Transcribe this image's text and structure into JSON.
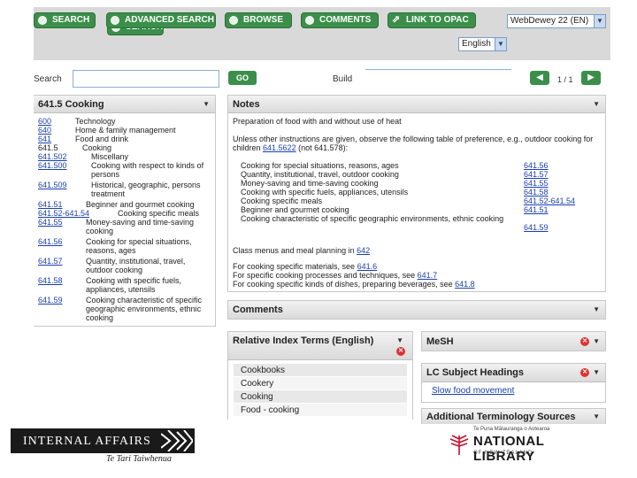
{
  "toolbar": {
    "buttons": [
      "SEARCH",
      "ADVANCED SEARCH",
      "BROWSE",
      "COMMENTS",
      "LINK TO OPAC"
    ],
    "edition": "WebDewey 22 (EN)",
    "language": "English"
  },
  "search": {
    "label": "Search",
    "value": "",
    "go": "GO",
    "build_label": "Build",
    "pager": "1 / 1"
  },
  "hierarchy": {
    "title": "641.5 Cooking",
    "rows": [
      {
        "num": "600",
        "cap": "Technology"
      },
      {
        "num": "640",
        "cap": "Home & family management"
      },
      {
        "num": "641",
        "cap": "Food and drink"
      },
      {
        "num": "641.5",
        "cap": "Cooking"
      },
      {
        "num": "641.502",
        "cap": "Miscellany"
      },
      {
        "num": "641.500",
        "cap": "Cooking with respect to kinds of persons"
      },
      {
        "num": "641.509",
        "cap": "Historical, geographic, persons treatment"
      },
      {
        "num": "641.51",
        "cap": "Beginner and gourmet cooking"
      },
      {
        "num": "641.52-641.54",
        "cap": "Cooking specific meals"
      },
      {
        "num": "641.55",
        "cap": "Money-saving and time-saving cooking"
      },
      {
        "num": "641.56",
        "cap": "Cooking for special situations, reasons, ages"
      },
      {
        "num": "641.57",
        "cap": "Quantity, institutional, travel, outdoor cooking"
      },
      {
        "num": "641.58",
        "cap": "Cooking with specific fuels, appliances, utensils"
      },
      {
        "num": "641.59",
        "cap": "Cooking characteristic of specific geographic environments, ethnic cooking"
      }
    ]
  },
  "notes": {
    "title": "Notes",
    "definition": "Preparation of food with and without use of heat",
    "instruction_a": "Unless other instructions are given, observe the following table of preference, e.g., outdoor cooking for children ",
    "instruction_link": "641.5622",
    "instruction_b": " (not 641.578):",
    "table": [
      {
        "t": "Cooking for special situations, reasons, ages",
        "v": "641.56"
      },
      {
        "t": "Quantity, institutional, travel, outdoor cooking",
        "v": "641.57"
      },
      {
        "t": "Money-saving and time-saving cooking",
        "v": "641.55"
      },
      {
        "t": "Cooking with specific fuels, appliances, utensils",
        "v": "641.58"
      },
      {
        "t": "Cooking specific meals",
        "v": "641.52-641.54"
      },
      {
        "t": "Beginner and gourmet cooking",
        "v": "641.51"
      },
      {
        "t": "Cooking characteristic of specific geographic environments, ethnic cooking",
        "v": "641.59"
      }
    ],
    "menus_text": "Class menus and meal planning in ",
    "menus_link": "642",
    "see1_text": "For cooking specific materials, see ",
    "see1_link": "641.6",
    "see2_text": "For specific cooking processes and techniques, see ",
    "see2_link": "641.7",
    "see3_text": "For cooking specific kinds of dishes, preparing beverages, see ",
    "see3_link": "641.8"
  },
  "comments": {
    "title": "Comments"
  },
  "relative_index": {
    "title": "Relative Index Terms (English)",
    "terms": [
      "Cookbooks",
      "Cookery",
      "Cooking",
      "Food - cooking"
    ]
  },
  "mesh": {
    "title": "MeSH"
  },
  "lcsh": {
    "title": "LC Subject Headings",
    "items": [
      "Slow food movement"
    ]
  },
  "additional": {
    "title": "Additional Terminology Sources"
  },
  "logos": {
    "ia_name": "INTERNAL AFFAIRS",
    "ia_maori": "Te Tari Taiwhenua",
    "nl_maori": "Te Puna Mātauranga o Aotearoa",
    "nl_name": "NATIONAL LIBRARY",
    "nl_sub": "OF NEW ZEALAND"
  },
  "colors": {
    "accent": "#3b8f4a",
    "link": "#1a3fb0",
    "panel_header": "#dadada",
    "nl_red": "#c8102e"
  }
}
